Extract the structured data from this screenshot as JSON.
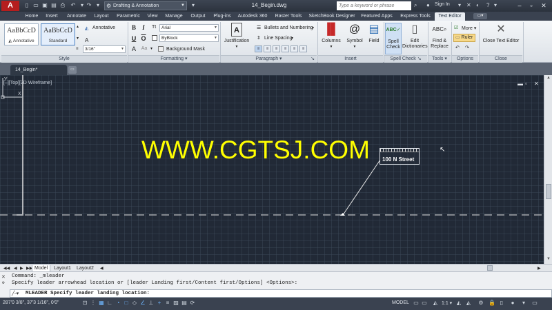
{
  "app": {
    "logo": "A",
    "workspace": "Drafting & Annotation",
    "document_title": "14_Begin.dwg",
    "search_placeholder": "Type a keyword or phrase",
    "sign_in": "Sign In"
  },
  "ribbon_tabs": [
    "Home",
    "Insert",
    "Annotate",
    "Layout",
    "Parametric",
    "View",
    "Manage",
    "Output",
    "Plug-ins",
    "Autodesk 360",
    "Raster Tools",
    "SketchBook Designer",
    "Featured Apps",
    "Express Tools",
    "Text Editor"
  ],
  "active_tab": "Text Editor",
  "ribbon": {
    "style": {
      "swatch_text": "AaBbCcD",
      "swatch1_label": "Annotative",
      "swatch2_label": "Standard",
      "annotative_label": "Annotative",
      "text_height": "3/16\"",
      "panel_title": "Style"
    },
    "formatting": {
      "bold": "B",
      "italic": "I",
      "font": "Arial",
      "underline": "U",
      "overline": "O",
      "color": "ByBlock",
      "match": "A",
      "case": "Aa",
      "background_mask": "Background Mask",
      "panel_title": "Formatting"
    },
    "paragraph": {
      "justification": "Justification",
      "bullets": "Bullets and Numbering",
      "line_spacing": "Line Spacing",
      "panel_title": "Paragraph"
    },
    "insert": {
      "columns": "Columns",
      "symbol": "Symbol",
      "field": "Field",
      "panel_title": "Insert"
    },
    "spell_check": {
      "spell_check": "Spell Check",
      "edit_dictionaries": "Edit Dictionaries",
      "panel_title": "Spell Check"
    },
    "tools": {
      "find_replace": "Find & Replace",
      "panel_title": "Tools"
    },
    "options": {
      "more": "More",
      "ruler": "Ruler",
      "panel_title": "Options"
    },
    "close": {
      "close_text_editor": "Close Text Editor",
      "panel_title": "Close"
    }
  },
  "doc_tab": "14_Begin*",
  "viewport_label": "[–][Top][2D Wireframe]",
  "watermark": "WWW.CGTSJ.COM",
  "mtext": "100 N Street",
  "layout_tabs": [
    "Model",
    "Layout1",
    "Layout2"
  ],
  "command": {
    "lines": [
      "Command: _mleader",
      "Specify leader arrowhead location or [leader Landing first/Content first/Options] <Options>:"
    ],
    "prompt": "MLEADER Specify leader landing location:"
  },
  "status": {
    "coordinates": "287'0 3/8\", 37'3 1/16\", 0'0\"",
    "model": "MODEL",
    "scale": "1:1"
  }
}
